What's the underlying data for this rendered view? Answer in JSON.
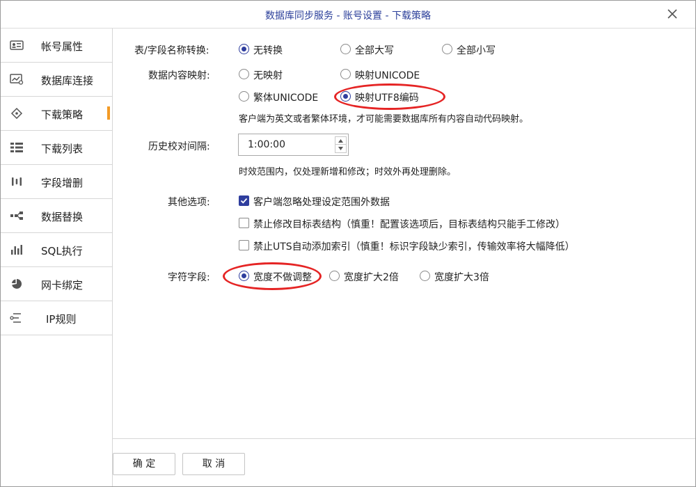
{
  "window": {
    "title": "数据库同步服务 - 账号设置 - 下载策略",
    "close_icon": "close-icon"
  },
  "colors": {
    "accent": "#2f3e9e",
    "active_marker": "#f39b26",
    "annotation": "#e52424",
    "title_text": "#2b3f9a"
  },
  "sidebar": {
    "items": [
      {
        "label": "帐号属性",
        "icon": "account-properties-icon"
      },
      {
        "label": "数据库连接",
        "icon": "database-connection-icon"
      },
      {
        "label": "下载策略",
        "icon": "download-strategy-icon",
        "active": true
      },
      {
        "label": "下载列表",
        "icon": "download-list-icon"
      },
      {
        "label": "字段增删",
        "icon": "field-add-remove-icon"
      },
      {
        "label": "数据替换",
        "icon": "data-replace-icon"
      },
      {
        "label": "SQL执行",
        "icon": "sql-execute-icon"
      },
      {
        "label": "网卡绑定",
        "icon": "nic-binding-icon"
      },
      {
        "label": "IP规则",
        "icon": "ip-rules-icon"
      }
    ]
  },
  "form": {
    "name_conversion": {
      "label": "表/字段名称转换:",
      "options": [
        "无转换",
        "全部大写",
        "全部小写"
      ],
      "selected": "无转换"
    },
    "content_mapping": {
      "label": "数据内容映射:",
      "options": [
        "无映射",
        "映射UNICODE",
        "繁体UNICODE",
        "映射UTF8编码"
      ],
      "selected": "映射UTF8编码",
      "hint": "客户端为英文或者繁体环境，才可能需要数据库所有内容自动代码映射。"
    },
    "history_interval": {
      "label": "历史校对间隔:",
      "value": "1:00:00",
      "hint": "时效范围内，仅处理新增和修改；时效外再处理删除。"
    },
    "other_options": {
      "label": "其他选项:",
      "items": [
        {
          "label": "客户端忽略处理设定范围外数据",
          "checked": true
        },
        {
          "label": "禁止修改目标表结构（慎重！配置该选项后，目标表结构只能手工修改）",
          "checked": false
        },
        {
          "label": "禁止UTS自动添加索引（慎重！标识字段缺少索引，传输效率将大幅降低）",
          "checked": false
        }
      ]
    },
    "char_field": {
      "label": "字符字段:",
      "options": [
        "宽度不做调整",
        "宽度扩大2倍",
        "宽度扩大3倍"
      ],
      "selected": "宽度不做调整"
    }
  },
  "footer": {
    "ok_label": "确 定",
    "cancel_label": "取 消"
  }
}
